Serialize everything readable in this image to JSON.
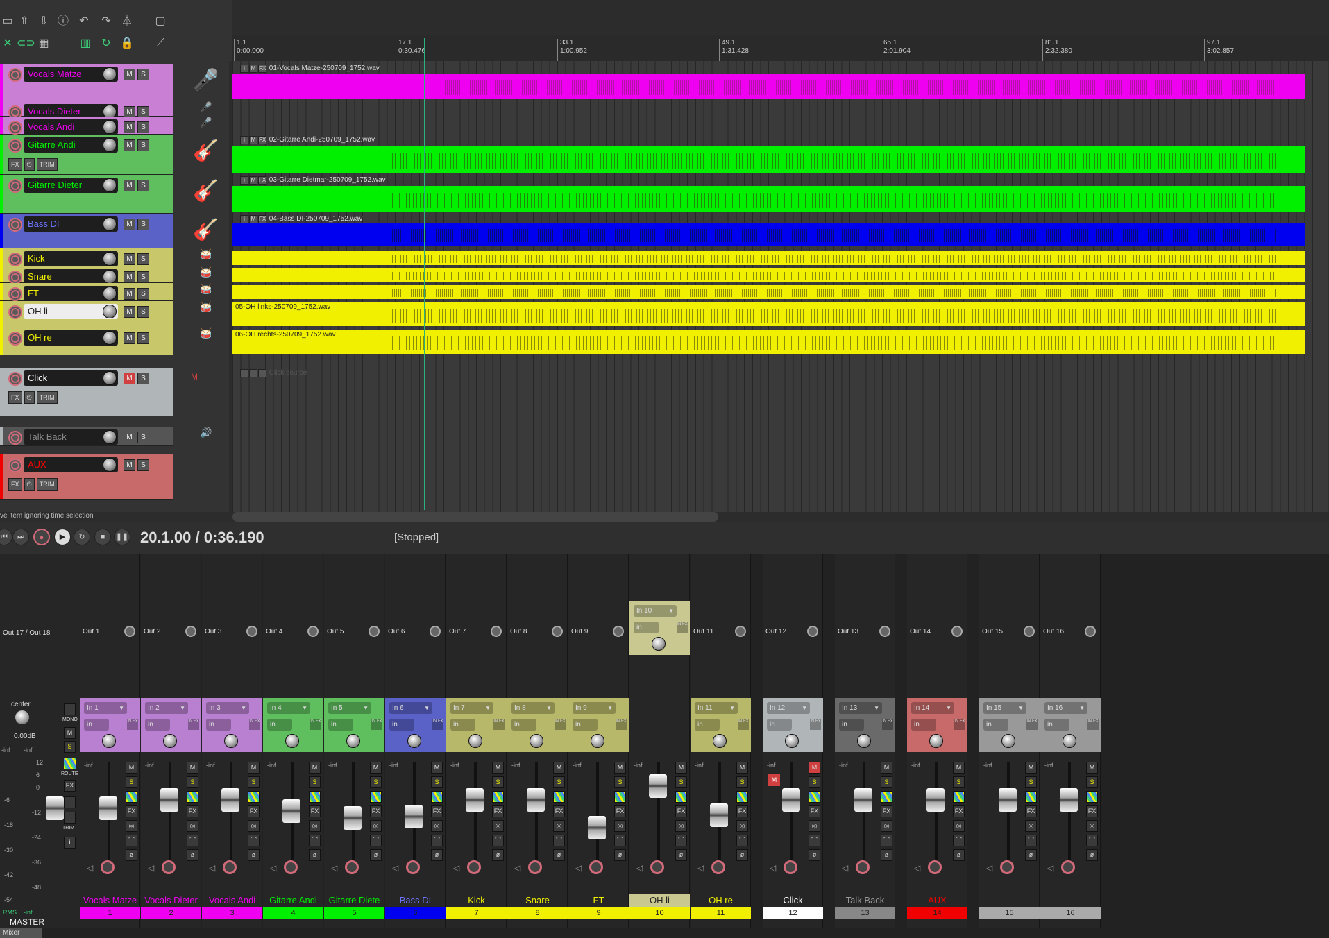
{
  "colors": {
    "pink": "#f000f0",
    "green": "#00f000",
    "blue": "#0000f0",
    "yellow": "#f0f000",
    "grey": "#b0b6b8",
    "red": "#f00000",
    "cursor": "#2bb07f"
  },
  "ruler": [
    {
      "bar": "1.1",
      "time": "0:00.000"
    },
    {
      "bar": "17.1",
      "time": "0:30.476"
    },
    {
      "bar": "33.1",
      "time": "1:00.952"
    },
    {
      "bar": "49.1",
      "time": "1:31.428"
    },
    {
      "bar": "65.1",
      "time": "2:01.904"
    },
    {
      "bar": "81.1",
      "time": "2:32.380"
    },
    {
      "bar": "97.1",
      "time": "3:02.857"
    }
  ],
  "tracks": [
    {
      "name": "Vocals Matze",
      "color": "#c97fd4",
      "icon": "microphone-icon"
    },
    {
      "name": "Vocals Dieter",
      "color": "#c97fd4",
      "icon": "microphone-icon"
    },
    {
      "name": "Vocals Andi",
      "color": "#c97fd4",
      "icon": "microphone-icon"
    },
    {
      "name": "Gitarre Andi",
      "color": "#5fbf5f",
      "icon": "guitar-icon"
    },
    {
      "name": "Gitarre Dieter",
      "color": "#5fbf5f",
      "icon": "guitar-icon"
    },
    {
      "name": "Bass DI",
      "color": "#5a62c8",
      "icon": "bass-icon"
    },
    {
      "name": "Kick",
      "color": "#c8c86a",
      "icon": "drum-icon"
    },
    {
      "name": "Snare",
      "color": "#c8c86a",
      "icon": "drum-icon"
    },
    {
      "name": "FT",
      "color": "#c8c86a",
      "icon": "drum-icon"
    },
    {
      "name": "OH li",
      "color": "#c8c86a",
      "icon": "drum-icon"
    },
    {
      "name": "OH re",
      "color": "#c8c86a",
      "icon": "drum-icon"
    },
    {
      "name": "Click",
      "color": "#b0b6b8",
      "icon": "metronome-icon"
    },
    {
      "name": "Talk Back",
      "color": "#555",
      "icon": "speaker-icon"
    },
    {
      "name": "AUX",
      "color": "#c86a6a",
      "icon": "none"
    }
  ],
  "track_buttons": {
    "mute": "M",
    "solo": "S",
    "fx": "FX",
    "trim": "TRIM"
  },
  "items": [
    {
      "label": "01-Vocals Matze-250709_1752.wav"
    },
    {
      "label": "02-Gitarre Andi-250709_1752.wav"
    },
    {
      "label": "03-Gitarre Dietmar-250709_1752.wav"
    },
    {
      "label": "04-Bass DI-250709_1752.wav"
    },
    {
      "label": "05-OH links-250709_1752.wav"
    },
    {
      "label": "06-OH rechts-250709_1752.wav"
    },
    {
      "label": "Click source"
    }
  ],
  "transport": {
    "position": "20.1.00 / 0:36.190",
    "status": "[Stopped]",
    "hint": "ve item ignoring time selection"
  },
  "master": {
    "label": "MASTER",
    "pan": "center",
    "volume": "0.00dB",
    "out": "Out 17 / Out 18",
    "mono": "MONO",
    "route": "ROUTE",
    "trim": "TRIM",
    "inf": "-inf",
    "rms": "RMS",
    "scale": [
      "12",
      "6",
      "0",
      "-6",
      "-12",
      "-18",
      "-24",
      "-30",
      "-36",
      "-42",
      "-48",
      "-54"
    ]
  },
  "strips": [
    {
      "name": "Vocals Matze",
      "num": "1",
      "out": "Out 1",
      "in": "In 1",
      "mode": "in",
      "color": "#b97fd0",
      "numcolor": "#f000f0",
      "namecolor": "#f000f0"
    },
    {
      "name": "Vocals Dieter",
      "num": "2",
      "out": "Out 2",
      "in": "In 2",
      "mode": "in",
      "color": "#b97fd0",
      "numcolor": "#f000f0",
      "namecolor": "#f000f0"
    },
    {
      "name": "Vocals Andi",
      "num": "3",
      "out": "Out 3",
      "in": "In 3",
      "mode": "in",
      "color": "#b97fd0",
      "numcolor": "#f000f0",
      "namecolor": "#f000f0"
    },
    {
      "name": "Gitarre Andi",
      "num": "4",
      "out": "Out 4",
      "in": "In 4",
      "mode": "in",
      "color": "#5fbf5f",
      "numcolor": "#00f000",
      "namecolor": "#00f000"
    },
    {
      "name": "Gitarre Diete",
      "num": "5",
      "out": "Out 5",
      "in": "In 5",
      "mode": "in",
      "color": "#5fbf5f",
      "numcolor": "#00f000",
      "namecolor": "#00f000"
    },
    {
      "name": "Bass DI",
      "num": "6",
      "out": "Out 6",
      "in": "In 6",
      "mode": "in",
      "color": "#5a62c8",
      "numcolor": "#0000f0",
      "namecolor": "#6c74ff"
    },
    {
      "name": "Kick",
      "num": "7",
      "out": "Out 7",
      "in": "In 7",
      "mode": "in",
      "color": "#b8b86a",
      "numcolor": "#f0f000",
      "namecolor": "#f0f000"
    },
    {
      "name": "Snare",
      "num": "8",
      "out": "Out 8",
      "in": "In 8",
      "mode": "in",
      "color": "#b8b86a",
      "numcolor": "#f0f000",
      "namecolor": "#f0f000"
    },
    {
      "name": "FT",
      "num": "9",
      "out": "Out 9",
      "in": "In 9",
      "mode": "in",
      "color": "#b8b86a",
      "numcolor": "#f0f000",
      "namecolor": "#f0f000"
    },
    {
      "name": "OH li",
      "num": "10",
      "out": "",
      "in": "In 10",
      "mode": "in",
      "color": "#c8c890",
      "numcolor": "#f0f000",
      "namecolor": "#222"
    },
    {
      "name": "OH re",
      "num": "11",
      "out": "Out 11",
      "in": "In 11",
      "mode": "in",
      "color": "#b8b86a",
      "numcolor": "#f0f000",
      "namecolor": "#f0f000"
    },
    {
      "name": "Click",
      "num": "12",
      "out": "Out 12",
      "in": "In 12",
      "mode": "in",
      "color": "#b0b6b8",
      "numcolor": "#ffffff",
      "namecolor": "#ffffff"
    },
    {
      "name": "Talk Back",
      "num": "13",
      "out": "Out 13",
      "in": "In 13",
      "mode": "in",
      "color": "#6a6a6a",
      "numcolor": "#888888",
      "namecolor": "#999"
    },
    {
      "name": "AUX",
      "num": "14",
      "out": "Out 14",
      "in": "In 14",
      "mode": "in",
      "color": "#c86a6a",
      "numcolor": "#f00000",
      "namecolor": "#f00000"
    },
    {
      "name": "",
      "num": "15",
      "out": "Out 15",
      "in": "In 15",
      "mode": "in",
      "color": "#999",
      "numcolor": "#aaaaaa",
      "namecolor": "#ccc"
    },
    {
      "name": "",
      "num": "16",
      "out": "Out 16",
      "in": "In 16",
      "mode": "in",
      "color": "#999",
      "numcolor": "#aaaaaa",
      "namecolor": "#ccc"
    }
  ],
  "strip_buttons": {
    "mute": "M",
    "solo": "S",
    "fx": "FX",
    "inf": "-inf",
    "infx": "IN FX"
  },
  "mixer_tab": "Mixer"
}
